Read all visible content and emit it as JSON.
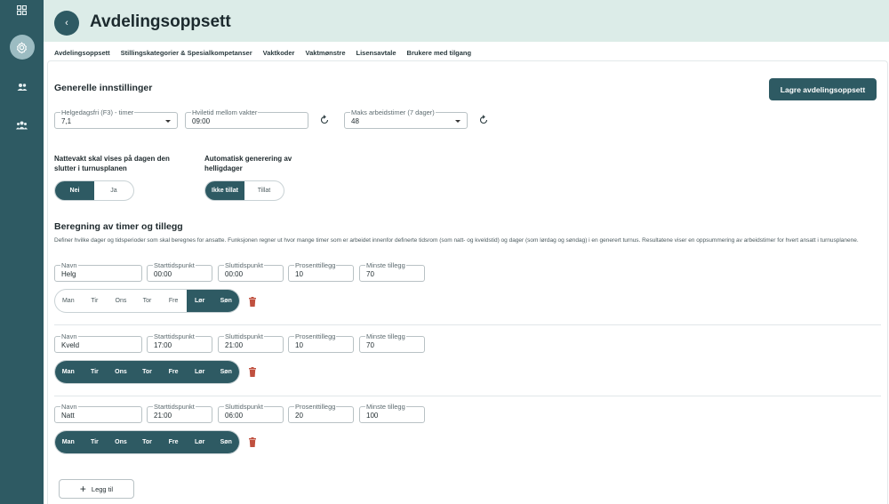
{
  "header": {
    "title": "Avdelingsoppsett",
    "crumb": ""
  },
  "sidebar": {
    "icons": [
      "dashboard-icon",
      "gear-icon",
      "users-icon",
      "group-icon"
    ]
  },
  "tabs": [
    {
      "label": "Avdelingsoppsett",
      "active": true
    },
    {
      "label": "Stillingskategorier & Spesialkompetanser",
      "active": false
    },
    {
      "label": "Vaktkoder",
      "active": false
    },
    {
      "label": "Vaktmønstre",
      "active": false
    },
    {
      "label": "Lisensavtale",
      "active": false
    },
    {
      "label": "Brukere med tilgang",
      "active": false
    }
  ],
  "general": {
    "heading": "Generelle innstillinger",
    "save_label": "Lagre avdelingsoppsett",
    "fields": {
      "holiday": {
        "label": "Helgedagsfri (F3) - timer",
        "value": "7,1"
      },
      "rest": {
        "label": "Hviletid mellom vakter",
        "value": "09:00"
      },
      "max_hours": {
        "label": "Maks arbeidstimer (7 dager)",
        "value": "48"
      }
    },
    "night_label": "Nattevakt skal vises på dagen den slutter i turnusplanen",
    "night_options": [
      "Nei",
      "Ja"
    ],
    "auto_label": "Automatisk generering av helligdager",
    "auto_options": [
      "Ikke tillat",
      "Tillat"
    ]
  },
  "calc": {
    "heading": "Beregning av timer og tillegg",
    "description": "Definer hvilke dager og tidsperioder som skal beregnes for ansatte. Funksjonen regner ut hvor mange timer som er arbeidet innenfor definerte tidsrom (som natt- og kveldstid) og dager (som lørdag og søndag) i en generert turnus. Resultatene viser en oppsummering av arbeidstimer for hvert ansatt i turnusplanene.",
    "labels": {
      "name": "Navn",
      "start": "Starttidspunkt",
      "end": "Sluttidspunkt",
      "percent": "Prosenttillegg",
      "min": "Minste tillegg"
    },
    "day_names": [
      "Man",
      "Tir",
      "Ons",
      "Tor",
      "Fre",
      "Lør",
      "Søn"
    ],
    "rows": [
      {
        "name": "Helg",
        "start": "00:00",
        "end": "00:00",
        "percent": "10",
        "min": "70",
        "active_days": [
          false,
          false,
          false,
          false,
          false,
          true,
          true
        ]
      },
      {
        "name": "Kveld",
        "start": "17:00",
        "end": "21:00",
        "percent": "10",
        "min": "70",
        "active_days": [
          true,
          true,
          true,
          true,
          true,
          true,
          true
        ]
      },
      {
        "name": "Natt",
        "start": "21:00",
        "end": "06:00",
        "percent": "20",
        "min": "100",
        "active_days": [
          true,
          true,
          true,
          true,
          true,
          true,
          true
        ]
      }
    ],
    "add_label": "Legg til"
  },
  "colors": {
    "primary": "#2e5a63",
    "header_bg": "#dcece8",
    "trash": "#c0503f"
  }
}
